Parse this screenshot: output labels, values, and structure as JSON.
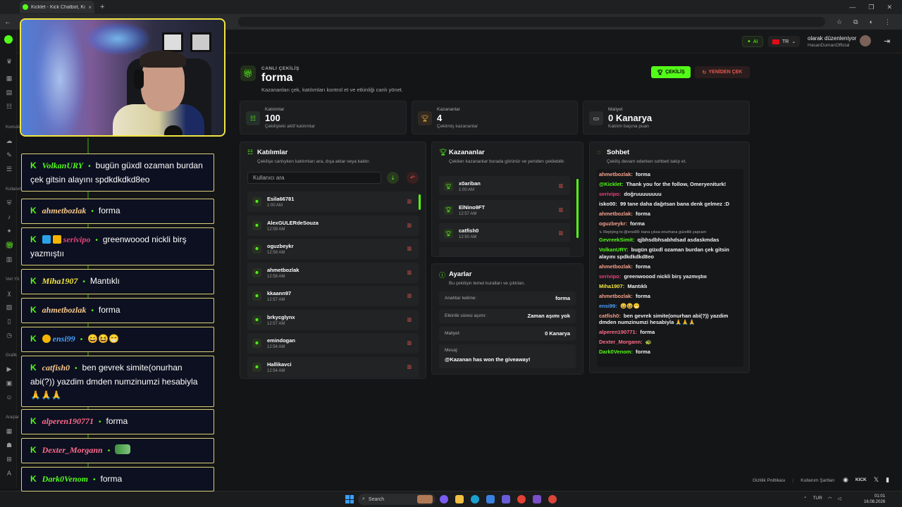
{
  "browser": {
    "tab_title": "Kicklet - Kick Chatbot, Kick Wi...",
    "tab_close": "×",
    "new_tab": "+",
    "win_controls": [
      "—",
      "❐",
      "✕"
    ]
  },
  "sidebar": {
    "sections": [
      "Komutlar",
      "Kullanım",
      "Veri Yö",
      "Grafik",
      "Araçlar"
    ]
  },
  "header": {
    "ai_label": "AI",
    "lang_label": "TR",
    "user_status": "olarak düzenleniyor",
    "user_name": "HasanDumanOfficial"
  },
  "page": {
    "kicker": "CANLI ÇEKİLİŞ",
    "title": "forma",
    "subtitle": "Kazananları çek, katılımları kontrol et ve etkinliği canlı yönet.",
    "draw_button": "ÇEKİLİŞ",
    "redraw_button": "YENİDEN ÇEK"
  },
  "stats": [
    {
      "label": "Katılımlar",
      "value": "100",
      "sub": "Çekilişteki aktif katılımlar",
      "icon": "users-icon"
    },
    {
      "label": "Kazananlar",
      "value": "4",
      "sub": "Çekilmiş kazananlar",
      "icon": "trophy-icon"
    },
    {
      "label": "Maliyet",
      "value": "0 Kanarya",
      "sub": "Katılım başına puan",
      "icon": "cash-icon"
    }
  ],
  "participants": {
    "title": "Katılımlar",
    "desc": "Çekilişe canlıyken katılımları ara, dışa aktar veya kaldır.",
    "search_placeholder": "Kullanıcı ara",
    "items": [
      {
        "name": "Esila66781",
        "time": "1:00 AM"
      },
      {
        "name": "AlexGULERdeSouza",
        "time": "12:59 AM"
      },
      {
        "name": "oguzbeykr",
        "time": "12:59 AM"
      },
      {
        "name": "ahmetbozlak",
        "time": "12:58 AM"
      },
      {
        "name": "kkaann97",
        "time": "12:57 AM"
      },
      {
        "name": "brkycglynx",
        "time": "12:57 AM"
      },
      {
        "name": "emindogan",
        "time": "12:54 AM"
      },
      {
        "name": "Hallikavci",
        "time": "12:54 AM"
      }
    ]
  },
  "winners": {
    "title": "Kazananlar",
    "desc": "Çekilen kazananlar burada görünür ve yeniden çekilebilir.",
    "items": [
      {
        "name": "x0ariban",
        "time": "1:00 AM"
      },
      {
        "name": "ElNino9FT",
        "time": "12:57 AM"
      },
      {
        "name": "catfish0",
        "time": "12:50 AM"
      }
    ]
  },
  "settings": {
    "title": "Ayarlar",
    "desc": "Bu çekilişin temel kuralları ve çıktıları.",
    "rows": [
      {
        "key": "Anahtar kelime:",
        "value": "forma"
      },
      {
        "key": "Etkinlik süresi aşımı:",
        "value": "Zaman aşımı yok"
      },
      {
        "key": "Maliyet:",
        "value": "0 Kanarya"
      }
    ],
    "message_key": "Mesaj:",
    "message_value": "@Kazanan has won the giveaway!"
  },
  "chat_panel": {
    "title": "Sohbet",
    "desc": "Çekiliş devam ederken sohbeti takip et.",
    "reply_note": "↳ Replying to @ensi99: bana çıksa onurhana güzellik yapcam",
    "messages": [
      {
        "user": "ahmetbozlak",
        "color": "#f7a08c",
        "text": "forma"
      },
      {
        "user": "@Kicklet",
        "color": "#53fc18",
        "text": "Thank you for the follow, Omeryeniturk!"
      },
      {
        "user": "serivipo",
        "color": "#e0457b",
        "text": "doğruuuuuuuu"
      },
      {
        "user": "isko00",
        "color": "#f2f2f2",
        "text": "99 tane daha dağıtsan bana denk gelmez :D"
      },
      {
        "user": "ahmetbozlak",
        "color": "#f7a08c",
        "text": "forma"
      },
      {
        "user": "oguzbeykr",
        "color": "#f7a08c",
        "text": "forma"
      },
      {
        "user": "GevreekSimit",
        "color": "#53fc18",
        "text": "qjbhsdbhsabhdsad asdaskmdas"
      },
      {
        "user": "VolkanURY",
        "color": "#53fc18",
        "text": "bugün güxdl ozaman burdan çek gitsin alayını spdkdkdkd8eo"
      },
      {
        "user": "ahmetbozlak",
        "color": "#f7a08c",
        "text": "forma"
      },
      {
        "user": "serivipo",
        "color": "#e0457b",
        "text": "greenwoood nickli birş yazmıştııı"
      },
      {
        "user": "Miha1907",
        "color": "#f2e542",
        "text": "Mantıklı"
      },
      {
        "user": "ahmetbozlak",
        "color": "#f7a08c",
        "text": "forma"
      },
      {
        "user": "ensi99",
        "color": "#4aa0ff",
        "text": "😄😆😁"
      },
      {
        "user": "catfish0",
        "color": "#f7a08c",
        "text": "ben gevrek simite(onurhan abi(?)) yazdim dmden numzinumzi hesabiyla 🙏🙏🙏"
      },
      {
        "user": "alperen190771",
        "color": "#ff6b8b",
        "text": "forma"
      },
      {
        "user": "Dexter_Morgann",
        "color": "#ff6b8b",
        "text": "🐢"
      },
      {
        "user": "Dark0Venom",
        "color": "#53fc18",
        "text": "forma"
      }
    ]
  },
  "overlay_chat": {
    "k_label": "K",
    "messages": [
      {
        "user": "VolkanURY",
        "color": "#53fc18",
        "text": "bugün güxdl ozaman burdan çek gitsin alayını spdkdkdkd8eo"
      },
      {
        "user": "ahmetbozlak",
        "color": "#f7c78c",
        "text": "forma"
      },
      {
        "user": "serivipo",
        "color": "#e0457b",
        "text": "greenwoood nickli birş yazmıştıı"
      },
      {
        "user": "Miha1907",
        "color": "#f2e542",
        "text": "Mantıklı"
      },
      {
        "user": "ahmetbozlak",
        "color": "#f7c78c",
        "text": "forma"
      },
      {
        "user": "ensi99",
        "color": "#4aa0ff",
        "text": "😄😆😁"
      },
      {
        "user": "catfish0",
        "color": "#f7c78c",
        "text": "ben gevrek simite(onurhan abi(?)) yazdim dmden numzinumzi hesabiyla 🙏🙏🙏"
      },
      {
        "user": "alperen190771",
        "color": "#ff6b8b",
        "text": "forma"
      },
      {
        "user": "Dexter_Morgann",
        "color": "#ff6b8b",
        "text": ""
      },
      {
        "user": "Dark0Venom",
        "color": "#53fc18",
        "text": "forma"
      }
    ]
  },
  "footer": {
    "privacy": "Gizlilik Politikası",
    "sep": "|",
    "terms": "Kullanım Şartları",
    "kick": "KICK"
  },
  "taskbar": {
    "search_label": "Search",
    "tray_lang": "TUR",
    "time": "01:01",
    "date": "16.08.2026"
  },
  "colors": {
    "accent": "#53fc18",
    "danger": "#e2584f",
    "overlay_border": "#f2e542"
  }
}
